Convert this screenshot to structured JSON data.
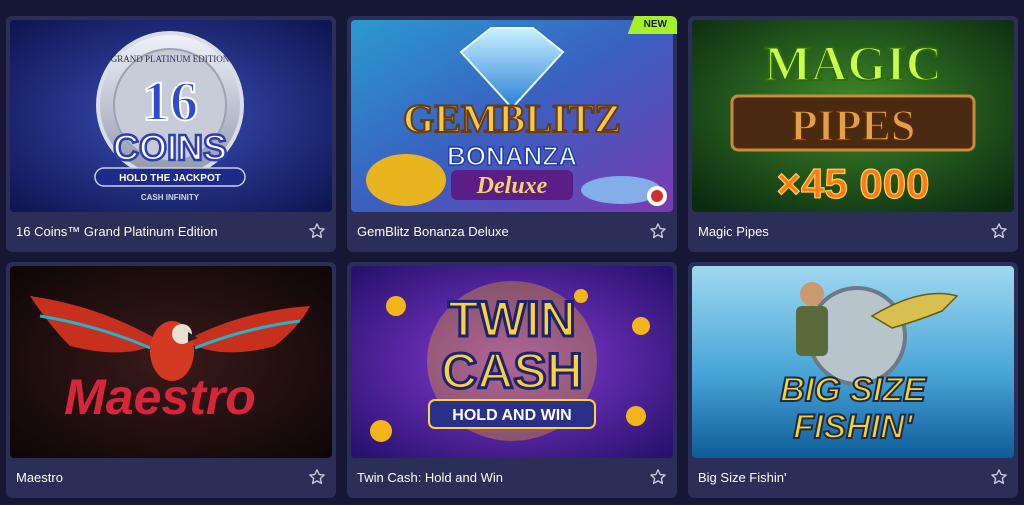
{
  "games": [
    {
      "title": "16 Coins™ Grand Platinum Edition",
      "art": {
        "line1": "16",
        "line2": "COINS",
        "line3": "HOLD THE JACKPOT",
        "ring": "GRAND PLATINUM EDITION",
        "sub": "CASH INFINITY"
      }
    },
    {
      "title": "GemBlitz Bonanza Deluxe",
      "badge": "NEW",
      "art": {
        "line1": "GEMBLITZ",
        "line2": "BONANZA",
        "line3": "Deluxe"
      }
    },
    {
      "title": "Magic Pipes",
      "art": {
        "line1": "MAGIC",
        "line2": "PIPES",
        "line3": "×45 000"
      }
    },
    {
      "title": "Maestro",
      "art": {
        "line1": "Maestro"
      }
    },
    {
      "title": "Twin Cash: Hold and Win",
      "art": {
        "line1": "TWIN",
        "line2": "CASH",
        "line3": "HOLD AND WIN"
      }
    },
    {
      "title": "Big Size Fishin'",
      "art": {
        "line1": "BIG SIZE",
        "line2": "FISHIN'"
      }
    }
  ],
  "icons": {
    "favorite": "star-outline-icon"
  },
  "colors": {
    "page_bg": "#151735",
    "card_bg": "#2b2e57",
    "badge": "#a6f02a"
  }
}
